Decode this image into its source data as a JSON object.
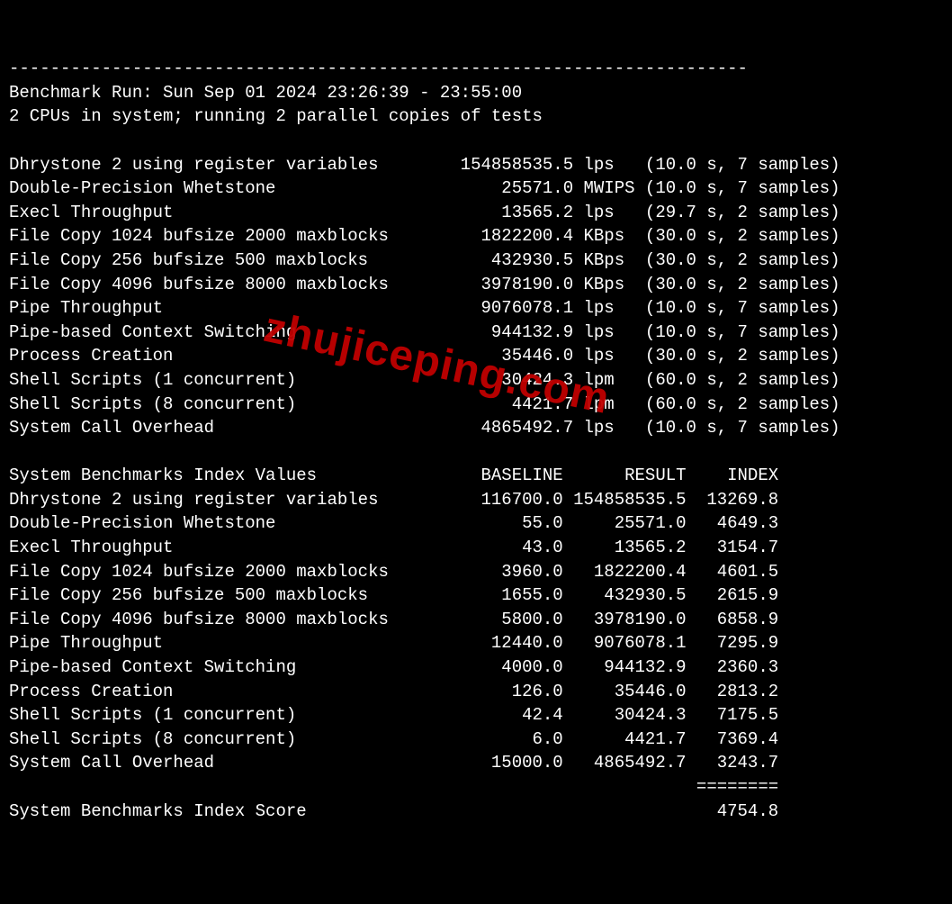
{
  "separator": "------------------------------------------------------------------------",
  "header": {
    "run_line": "Benchmark Run: Sun Sep 01 2024 23:26:39 - 23:55:00",
    "cpu_line": "2 CPUs in system; running 2 parallel copies of tests"
  },
  "tests": [
    {
      "name": "Dhrystone 2 using register variables",
      "value": "154858535.5",
      "unit": "lps",
      "timing": "(10.0 s, 7 samples)"
    },
    {
      "name": "Double-Precision Whetstone",
      "value": "25571.0",
      "unit": "MWIPS",
      "timing": "(10.0 s, 7 samples)"
    },
    {
      "name": "Execl Throughput",
      "value": "13565.2",
      "unit": "lps",
      "timing": "(29.7 s, 2 samples)"
    },
    {
      "name": "File Copy 1024 bufsize 2000 maxblocks",
      "value": "1822200.4",
      "unit": "KBps",
      "timing": "(30.0 s, 2 samples)"
    },
    {
      "name": "File Copy 256 bufsize 500 maxblocks",
      "value": "432930.5",
      "unit": "KBps",
      "timing": "(30.0 s, 2 samples)"
    },
    {
      "name": "File Copy 4096 bufsize 8000 maxblocks",
      "value": "3978190.0",
      "unit": "KBps",
      "timing": "(30.0 s, 2 samples)"
    },
    {
      "name": "Pipe Throughput",
      "value": "9076078.1",
      "unit": "lps",
      "timing": "(10.0 s, 7 samples)"
    },
    {
      "name": "Pipe-based Context Switching",
      "value": "944132.9",
      "unit": "lps",
      "timing": "(10.0 s, 7 samples)"
    },
    {
      "name": "Process Creation",
      "value": "35446.0",
      "unit": "lps",
      "timing": "(30.0 s, 2 samples)"
    },
    {
      "name": "Shell Scripts (1 concurrent)",
      "value": "30424.3",
      "unit": "lpm",
      "timing": "(60.0 s, 2 samples)"
    },
    {
      "name": "Shell Scripts (8 concurrent)",
      "value": "4421.7",
      "unit": "lpm",
      "timing": "(60.0 s, 2 samples)"
    },
    {
      "name": "System Call Overhead",
      "value": "4865492.7",
      "unit": "lps",
      "timing": "(10.0 s, 7 samples)"
    }
  ],
  "index_header": {
    "title": "System Benchmarks Index Values",
    "col1": "BASELINE",
    "col2": "RESULT",
    "col3": "INDEX"
  },
  "index_rows": [
    {
      "name": "Dhrystone 2 using register variables",
      "baseline": "116700.0",
      "result": "154858535.5",
      "index": "13269.8"
    },
    {
      "name": "Double-Precision Whetstone",
      "baseline": "55.0",
      "result": "25571.0",
      "index": "4649.3"
    },
    {
      "name": "Execl Throughput",
      "baseline": "43.0",
      "result": "13565.2",
      "index": "3154.7"
    },
    {
      "name": "File Copy 1024 bufsize 2000 maxblocks",
      "baseline": "3960.0",
      "result": "1822200.4",
      "index": "4601.5"
    },
    {
      "name": "File Copy 256 bufsize 500 maxblocks",
      "baseline": "1655.0",
      "result": "432930.5",
      "index": "2615.9"
    },
    {
      "name": "File Copy 4096 bufsize 8000 maxblocks",
      "baseline": "5800.0",
      "result": "3978190.0",
      "index": "6858.9"
    },
    {
      "name": "Pipe Throughput",
      "baseline": "12440.0",
      "result": "9076078.1",
      "index": "7295.9"
    },
    {
      "name": "Pipe-based Context Switching",
      "baseline": "4000.0",
      "result": "944132.9",
      "index": "2360.3"
    },
    {
      "name": "Process Creation",
      "baseline": "126.0",
      "result": "35446.0",
      "index": "2813.2"
    },
    {
      "name": "Shell Scripts (1 concurrent)",
      "baseline": "42.4",
      "result": "30424.3",
      "index": "7175.5"
    },
    {
      "name": "Shell Scripts (8 concurrent)",
      "baseline": "6.0",
      "result": "4421.7",
      "index": "7369.4"
    },
    {
      "name": "System Call Overhead",
      "baseline": "15000.0",
      "result": "4865492.7",
      "index": "3243.7"
    }
  ],
  "score_sep": "                                                                   ========",
  "score_line": {
    "label": "System Benchmarks Index Score",
    "value": "4754.8"
  },
  "watermark": "zhujiceping.com"
}
